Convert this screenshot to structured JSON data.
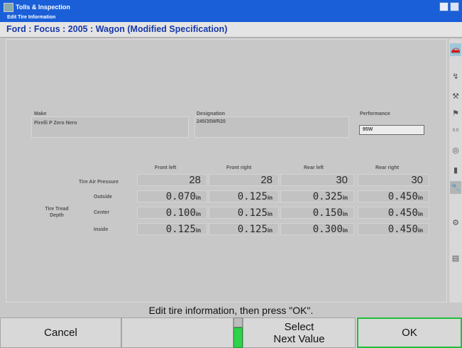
{
  "window": {
    "title": "Tolls & Inspection",
    "subtitle": "Edit Tire Information"
  },
  "vehicle": "Ford : Focus : 2005 : Wagon (Modified Specification)",
  "tire": {
    "make_label": "Make",
    "make_value": "Pirelli P Zero Nero",
    "designation_label": "Designation",
    "designation_value": "245/35WR20",
    "performance_label": "Performance",
    "performance_value": "95W"
  },
  "columns": [
    "Front left",
    "Front right",
    "Rear left",
    "Rear right"
  ],
  "rows": {
    "pressure_label": "Tire Air Pressure",
    "pressure": [
      "28",
      "28",
      "30",
      "30"
    ],
    "tread_label": "Tire Tread Depth",
    "outside_label": "Outside",
    "outside": [
      "0.070",
      "0.125",
      "0.325",
      "0.450"
    ],
    "center_label": "Center",
    "center": [
      "0.100",
      "0.125",
      "0.150",
      "0.450"
    ],
    "inside_label": "Inside",
    "inside": [
      "0.125",
      "0.125",
      "0.300",
      "0.450"
    ],
    "unit": "in"
  },
  "prompt": "Edit tire information, then press \"OK\".",
  "buttons": {
    "cancel": "Cancel",
    "select_line1": "Select",
    "select_line2": "Next Value",
    "ok": "OK"
  },
  "sidebar_icons": [
    "vehicle-icon",
    "alignment-icon",
    "tools-icon",
    "flag-icon",
    "readout-icon",
    "tire-icon",
    "battery-icon",
    "wrench-icon",
    "gauge-icon",
    "printer-icon"
  ]
}
